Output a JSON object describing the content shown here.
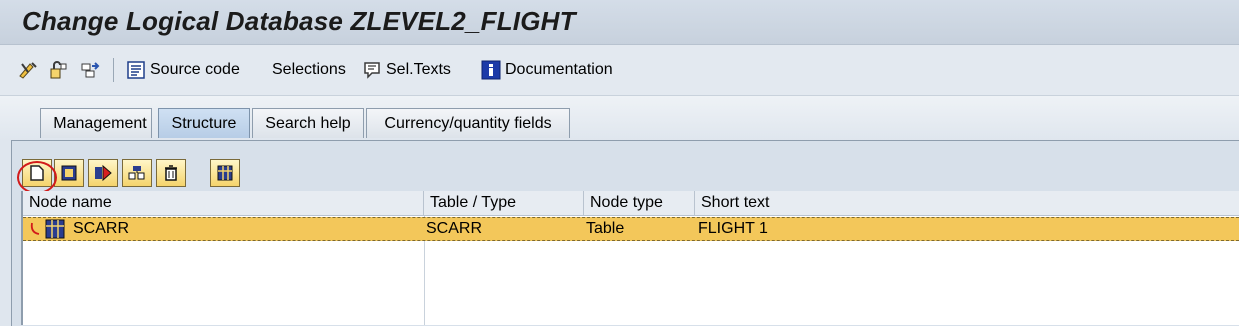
{
  "window": {
    "title": "Change Logical Database ZLEVEL2_FLIGHT"
  },
  "toolbar": {
    "icons": [
      "change-display-icon",
      "activate-icon",
      "navigate-icon"
    ],
    "source_code": "Source code",
    "selections": "Selections",
    "sel_texts": "Sel.Texts",
    "documentation": "Documentation"
  },
  "tabs": [
    {
      "label": "Management",
      "active": false
    },
    {
      "label": "Structure",
      "active": true
    },
    {
      "label": "Search help",
      "active": false
    },
    {
      "label": "Currency/quantity fields",
      "active": false
    }
  ],
  "structure_toolbar": {
    "buttons": [
      "create-node-icon",
      "change-node-icon",
      "move-node-icon",
      "node-details-icon",
      "delete-node-icon",
      "table-view-icon"
    ]
  },
  "tree": {
    "columns": [
      "Node name",
      "Table / Type",
      "Node type",
      "Short text"
    ],
    "rows": [
      {
        "node_name": "SCARR",
        "table_type": "SCARR",
        "node_type": "Table",
        "short_text": "FLIGHT 1",
        "selected": true
      }
    ]
  },
  "colors": {
    "title_bar": "#c7d1dd",
    "selected_row": "#f3c75a",
    "annotation": "#d21a1a"
  }
}
